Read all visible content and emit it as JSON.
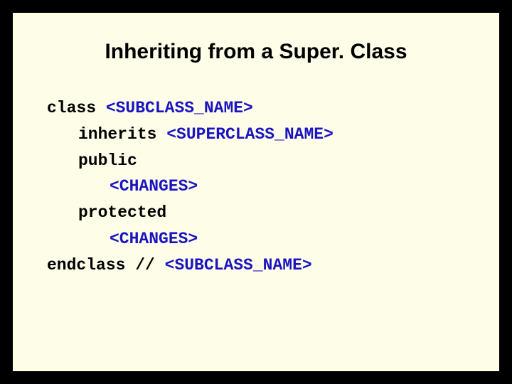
{
  "title": "Inheriting from a Super. Class",
  "code": {
    "kw_class": "class ",
    "ph_subclass": "<SUBCLASS_NAME>",
    "kw_inherits": "inherits ",
    "ph_superclass": "<SUPERCLASS_NAME>",
    "kw_public": "public",
    "ph_changes1": "<CHANGES>",
    "kw_protected": "protected",
    "ph_changes2": "<CHANGES>",
    "kw_endclass": "endclass // ",
    "ph_subclass_end": "<SUBCLASS_NAME>"
  }
}
